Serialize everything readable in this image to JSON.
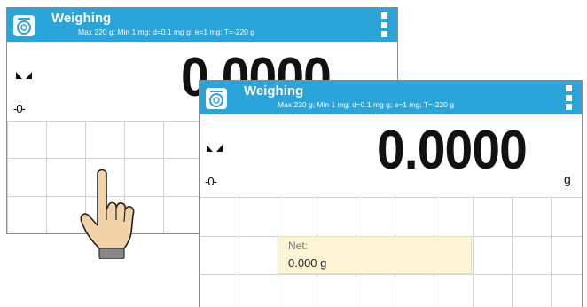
{
  "back_screen": {
    "title": "Weighing",
    "subtitle": "Max 220 g; Min 1 mg; d=0.1 mg g; e=1 mg; T=-220 g",
    "zero_indicator": "-0-",
    "reading": "0.0000",
    "icon": "scale-icon"
  },
  "front_screen": {
    "title": "Weighing",
    "subtitle": "Max 220 g; Min 1 mg; d=0.1 mg g; e=1 mg; T=-220 g",
    "zero_indicator": "-0-",
    "reading": "0.0000",
    "unit": "g",
    "net_label": "Net:",
    "net_value": "0.000 g",
    "icon": "scale-icon"
  },
  "colors": {
    "title_bar": "#2aa4d9",
    "net_field_bg": "#fdf5d6",
    "grid_line": "#d2d2d2"
  },
  "overlay": {
    "icon": "tapping-hand-icon"
  }
}
